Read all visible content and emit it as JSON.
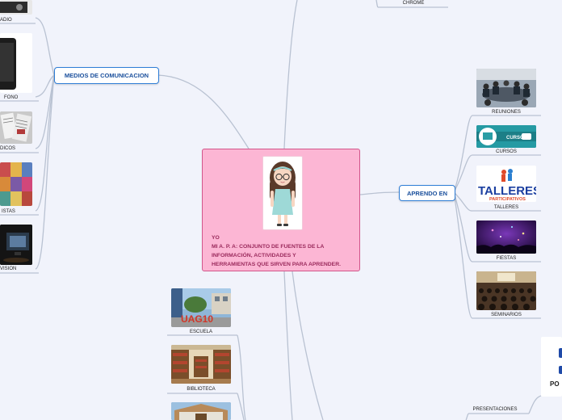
{
  "central": {
    "line1": "YO",
    "line2": "MI A. P. A: CONJUNTO DE FUENTES DE LA",
    "line3": "INFORMACIÓN, ACTIVIDADES Y",
    "line4": "HERRAMIENTAS QUE SIRVEN PARA APRENDER."
  },
  "topics": {
    "medios": "MEDIOS DE COMUNICACION",
    "aprendo": "APRENDO EN"
  },
  "left_items": {
    "radio": "ADIO",
    "telefono": "FONO",
    "periodicos": "DICOS",
    "revistas": "ISTAS",
    "television": "VISION"
  },
  "right_items": {
    "reuniones": "REUNIONES",
    "cursos": "CURSOS",
    "talleres": "TALLERES",
    "fiestas": "FIESTAS",
    "seminarios": "SEMINARIOS"
  },
  "bottom_items": {
    "escuela": "ESCUELA",
    "biblioteca": "BIBLIOTECA"
  },
  "misc": {
    "chrome": "CHROME",
    "presentaciones": "PRESENTACIONES"
  },
  "image_text": {
    "cursos_badge": "CURSOS",
    "talleres_title": "TALLERES",
    "talleres_sub": "PARTICIPATIVOS",
    "escuela_sign": "UAG10",
    "logo_fragment": "PO"
  },
  "colors": {
    "background": "#f1f3fb",
    "connector": "#b9c2d2",
    "topic_border": "#2e7dd6",
    "central_fill": "#fcb6d4",
    "central_border": "#d2558b"
  }
}
